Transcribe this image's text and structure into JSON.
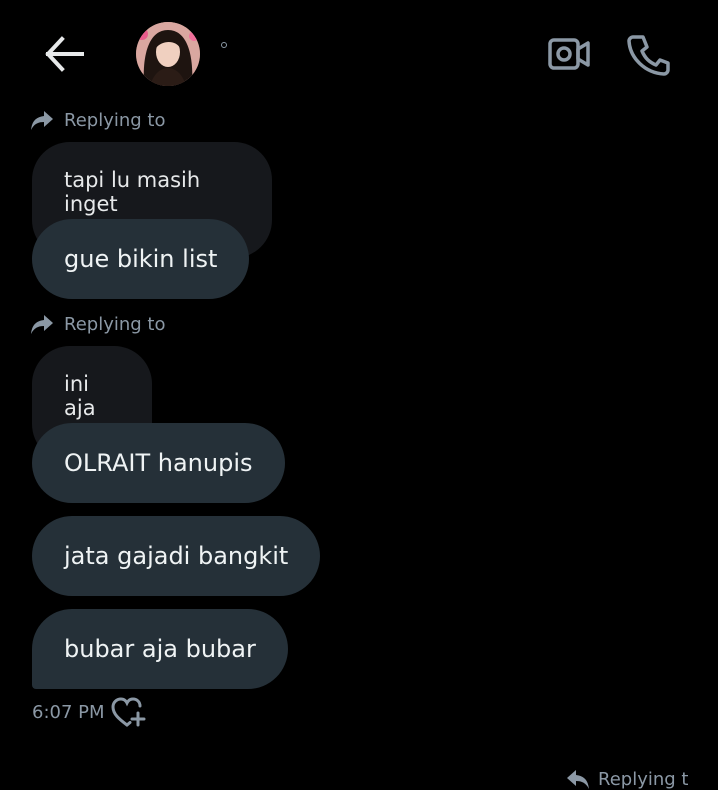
{
  "conversation": {
    "header": {
      "back_icon": "arrow-left-icon",
      "status_mark": "°",
      "video_icon": "video-camera-icon",
      "call_icon": "phone-icon"
    },
    "groups": [
      {
        "reply_label": "Replying to",
        "quoted_text": "tapi lu masih inget",
        "message": "gue bikin list"
      },
      {
        "reply_label": "Replying to",
        "quoted_text": "ini aja",
        "message": "OLRAIT hanupis"
      }
    ],
    "messages": [
      "jata gajadi bangkit",
      "bubar aja bubar"
    ],
    "timestamp": "6:07 PM",
    "react_icon": "heart-plus-icon",
    "next_reply_partial": "Replying t"
  },
  "colors": {
    "background": "#000000",
    "bubble": "#253038",
    "quoted_bubble": "#16181c",
    "text": "#eff3f4",
    "muted_text": "#8b98a5"
  }
}
